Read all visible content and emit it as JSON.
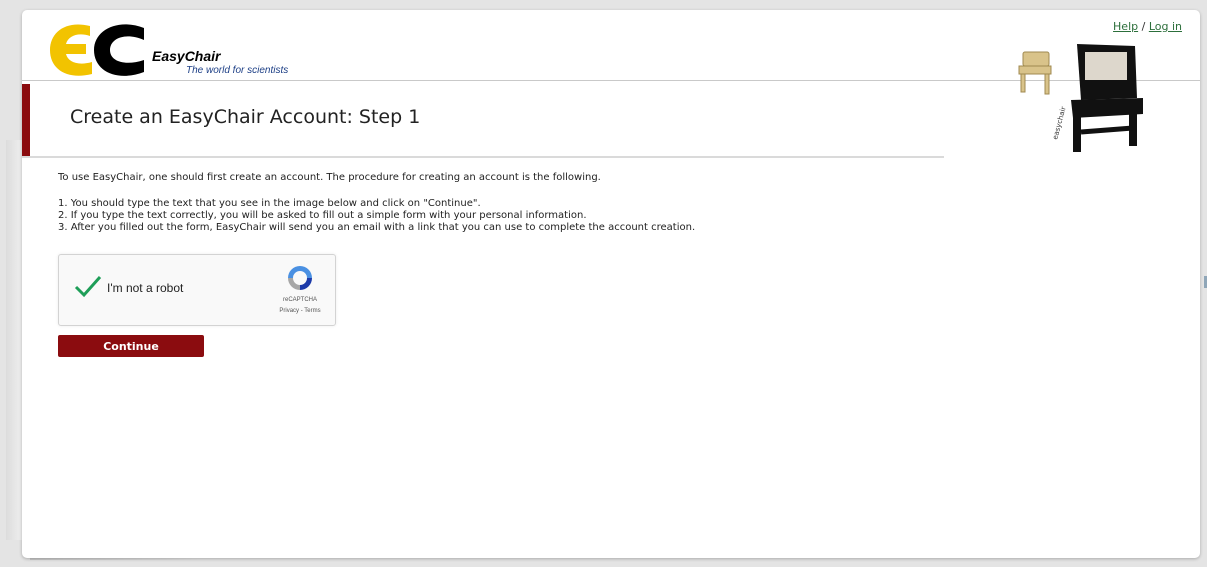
{
  "header": {
    "logo_name": "EasyChair",
    "logo_tagline": "The world for scientists",
    "help_link": "Help",
    "separator": "/",
    "login_link": "Log in"
  },
  "main": {
    "title": "Create an EasyChair Account: Step 1",
    "intro": "To use EasyChair, one should first create an account. The procedure for creating an account is the following.",
    "steps": [
      "1. You should type the text that you see in the image below and click on \"Continue\".",
      "2. If you type the text correctly, you will be asked to fill out a simple form with your personal information.",
      "3. After you filled out the form, EasyChair will send you an email with a link that you can use to complete the account creation."
    ]
  },
  "captcha": {
    "label": "I'm not a robot",
    "brand": "reCAPTCHA",
    "links": "Privacy - Terms",
    "checked": true
  },
  "actions": {
    "continue_label": "Continue"
  },
  "colors": {
    "accent": "#8b0c0f",
    "logo_yellow": "#f2c300",
    "link_green": "#2c6f3b",
    "check_green": "#1e9e58"
  }
}
